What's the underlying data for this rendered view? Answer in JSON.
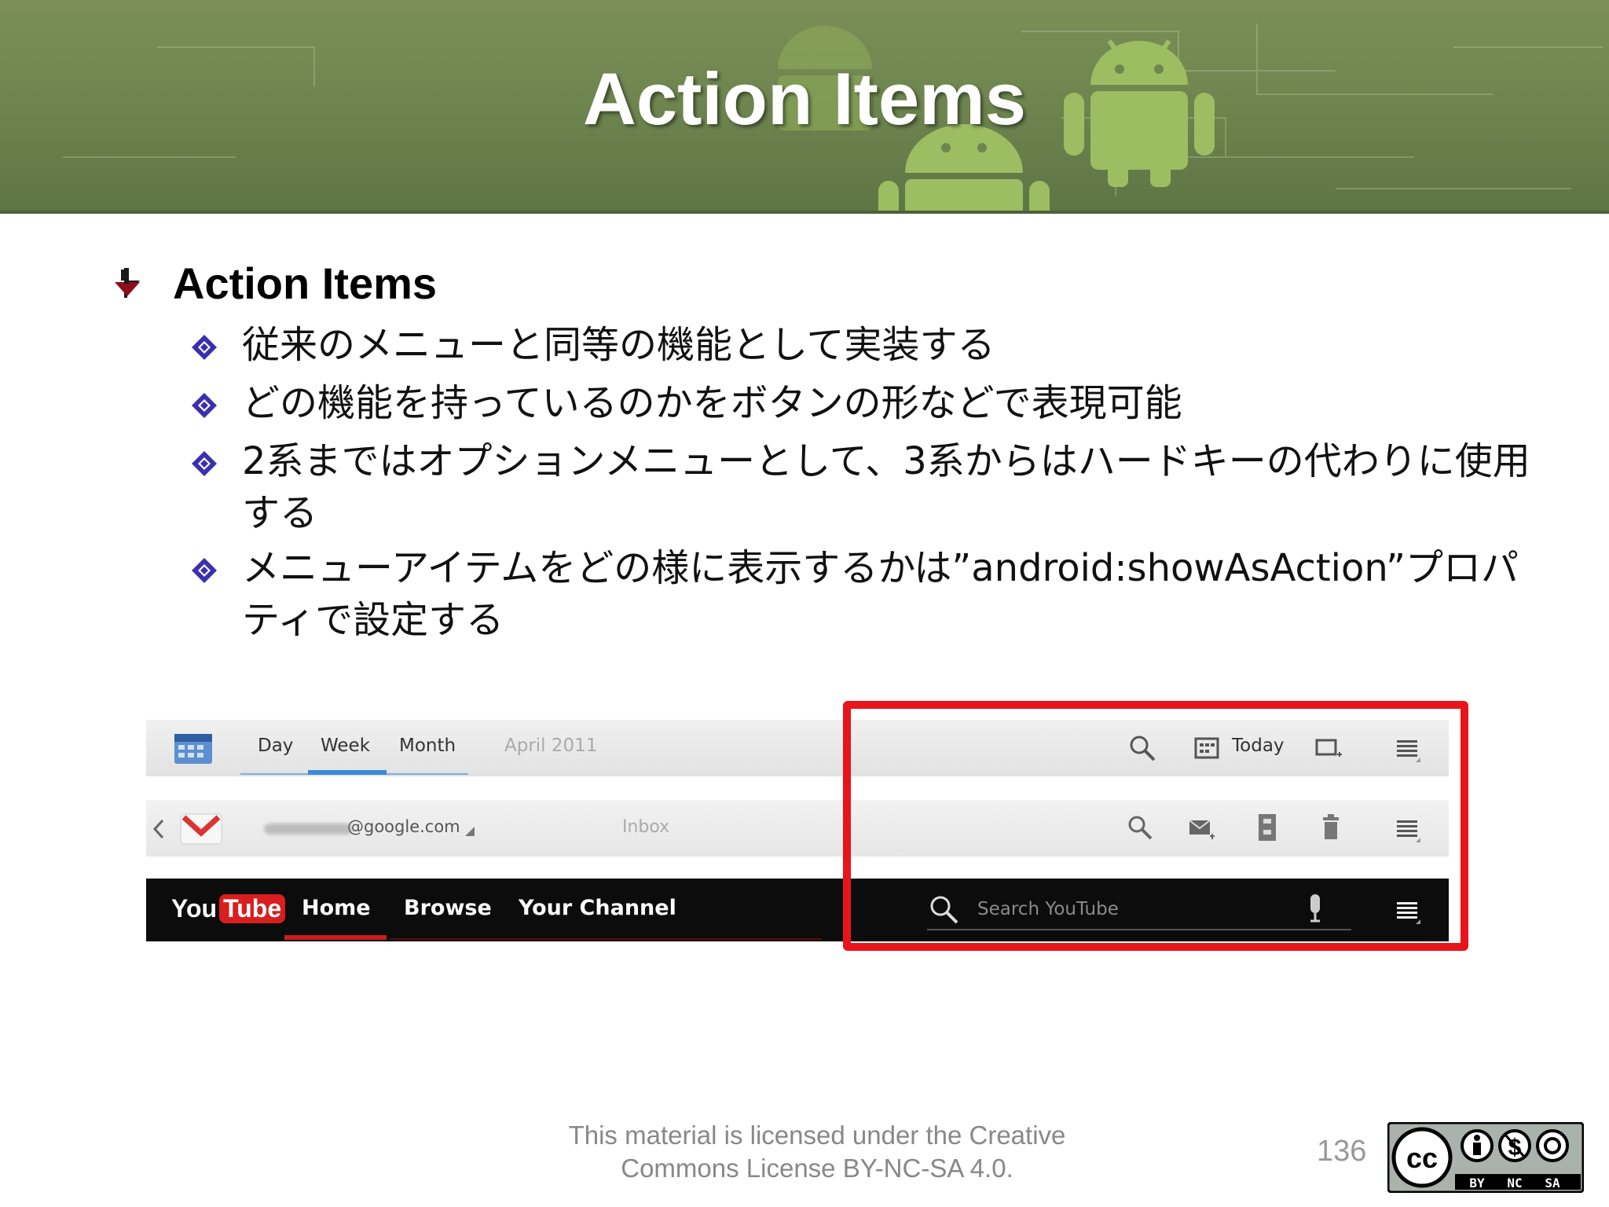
{
  "header": {
    "title": "Action Items"
  },
  "content": {
    "heading": "Action Items",
    "bullets": [
      "従来のメニューと同等の機能として実装する",
      "どの機能を持っているのかをボタンの形などで表現可能",
      "2系まではオプションメニューとして、3系からはハードキーの代わりに使用する",
      "メニューアイテムをどの様に表示するかは”android:showAsAction”プロパティで設定する"
    ]
  },
  "screenshots": {
    "calendar": {
      "tabs": [
        "Day",
        "Week",
        "Month"
      ],
      "date": "April 2011",
      "today_label": "Today"
    },
    "gmail": {
      "email": "@google.com",
      "folder": "Inbox"
    },
    "youtube": {
      "logo_you": "You",
      "logo_tube": "Tube",
      "nav": [
        "Home",
        "Browse",
        "Your Channel"
      ],
      "search_placeholder": "Search YouTube"
    },
    "highlight_color": "#e8141a"
  },
  "footer": {
    "license_line1": "This material is licensed under the Creative",
    "license_line2": "Commons License BY-NC-SA 4.0.",
    "page_number": "136",
    "badge_labels": [
      "BY",
      "NC",
      "SA"
    ]
  },
  "colors": {
    "banner": "#6f8650",
    "heading_arrow": "#8b0d1f",
    "bullet_diamond": "#3b2fb0"
  }
}
